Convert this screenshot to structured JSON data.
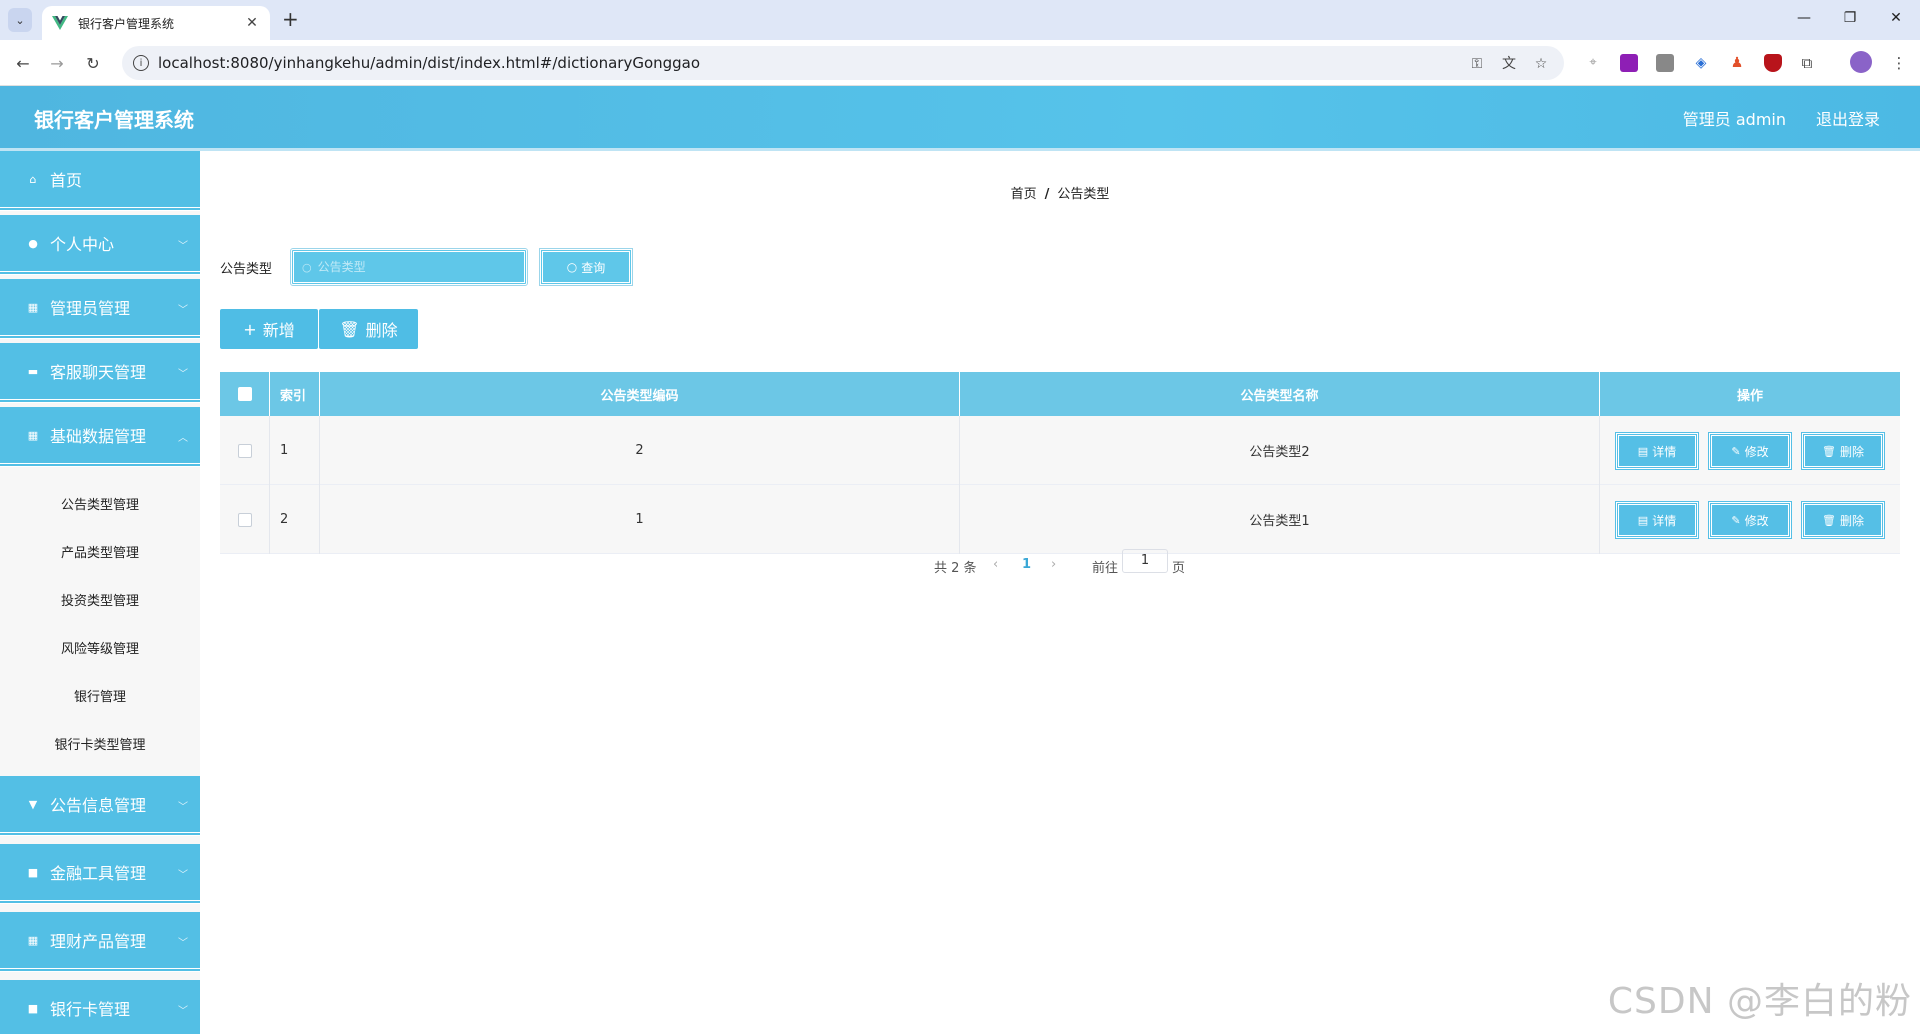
{
  "browser": {
    "tab_title": "银行客户管理系统",
    "url": "localhost:8080/yinhangkehu/admin/dist/index.html#/dictionaryGonggao"
  },
  "header": {
    "title": "银行客户管理系统",
    "user": "管理员 admin",
    "logout": "退出登录"
  },
  "sidebar": {
    "menus": [
      {
        "label": "首页",
        "icon": "home-icon"
      },
      {
        "label": "个人中心",
        "icon": "user-icon"
      },
      {
        "label": "管理员管理",
        "icon": "grid-icon"
      },
      {
        "label": "客服聊天管理",
        "icon": "briefcase-icon"
      },
      {
        "label": "基础数据管理",
        "icon": "grid-icon"
      }
    ],
    "submenus": [
      "公告类型管理",
      "产品类型管理",
      "投资类型管理",
      "风险等级管理",
      "银行管理",
      "银行卡类型管理"
    ],
    "menus_after": [
      {
        "label": "公告信息管理",
        "icon": "cup-icon"
      },
      {
        "label": "金融工具管理",
        "icon": "clipboard-icon"
      },
      {
        "label": "理财产品管理",
        "icon": "grid-icon"
      },
      {
        "label": "银行卡管理",
        "icon": "clipboard-icon"
      }
    ]
  },
  "breadcrumb": {
    "home": "首页",
    "current": "公告类型"
  },
  "search": {
    "label": "公告类型",
    "placeholder": "公告类型",
    "button": "查询"
  },
  "actions": {
    "add": "新增",
    "delete": "删除"
  },
  "table": {
    "headers": {
      "index": "索引",
      "code": "公告类型编码",
      "name": "公告类型名称",
      "ops": "操作"
    },
    "rows": [
      {
        "index": "1",
        "code": "2",
        "name": "公告类型2"
      },
      {
        "index": "2",
        "code": "1",
        "name": "公告类型1"
      }
    ],
    "op_labels": {
      "detail": "详情",
      "edit": "修改",
      "delete": "删除"
    }
  },
  "pagination": {
    "total": "共 2 条",
    "current_page": "1",
    "goto_label": "前往",
    "goto_value": "1",
    "page_unit": "页"
  },
  "watermark": "CSDN @李白的粉"
}
